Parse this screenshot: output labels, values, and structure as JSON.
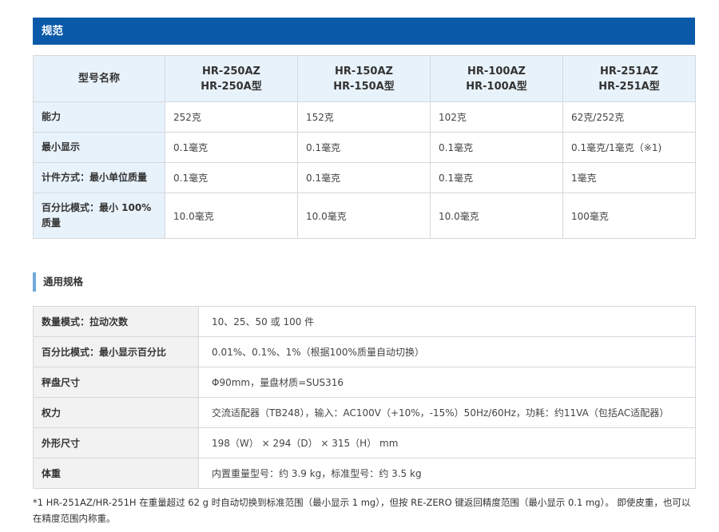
{
  "section": {
    "title": "规范"
  },
  "spec_table": {
    "header_label": "型号名称",
    "models": [
      {
        "line1": "HR-250AZ",
        "line2": "HR-250A型"
      },
      {
        "line1": "HR-150AZ",
        "line2": "HR-150A型"
      },
      {
        "line1": "HR-100AZ",
        "line2": "HR-100A型"
      },
      {
        "line1": "HR-251AZ",
        "line2": "HR-251A型"
      }
    ],
    "rows": [
      {
        "label": "能力",
        "values": [
          "252克",
          "152克",
          "102克",
          "62克/252克"
        ]
      },
      {
        "label": "最小显示",
        "values": [
          "0.1毫克",
          "0.1毫克",
          "0.1毫克",
          "0.1毫克/1毫克（※1)"
        ]
      },
      {
        "label": "计件方式：最小单位质量",
        "values": [
          "0.1毫克",
          "0.1毫克",
          "0.1毫克",
          "1毫克"
        ]
      },
      {
        "label": "百分比模式：最小 100% 质量",
        "values": [
          "10.0毫克",
          "10.0毫克",
          "10.0毫克",
          "100毫克"
        ]
      }
    ]
  },
  "general": {
    "heading": "通用规格",
    "rows": [
      {
        "label": "数量模式：拉动次数",
        "value": "10、25、50 或 100 件"
      },
      {
        "label": "百分比模式：最小显示百分比",
        "value": "0.01%、0.1%、1%（根据100%质量自动切换）"
      },
      {
        "label": "秤盘尺寸",
        "value": "Φ90mm，量盘材质=SUS316"
      },
      {
        "label": "权力",
        "value": "交流适配器（TB248），输入：AC100V（+10%，-15%）50Hz/60Hz，功耗：约11VA（包括AC适配器）"
      },
      {
        "label": "外形尺寸",
        "value": "198（W） × 294（D） × 315（H） mm"
      },
      {
        "label": "体重",
        "value": "内置重量型号：约 3.9 kg，标准型号：约 3.5 kg"
      }
    ]
  },
  "footnote": "*1 HR-251AZ/HR-251H 在重量超过 62 g 时自动切换到标准范围（最小显示 1 mg），但按 RE-ZERO 键返回精度范围（最小显示 0.1 mg）。 即使皮重，也可以在精度范围内称重。"
}
